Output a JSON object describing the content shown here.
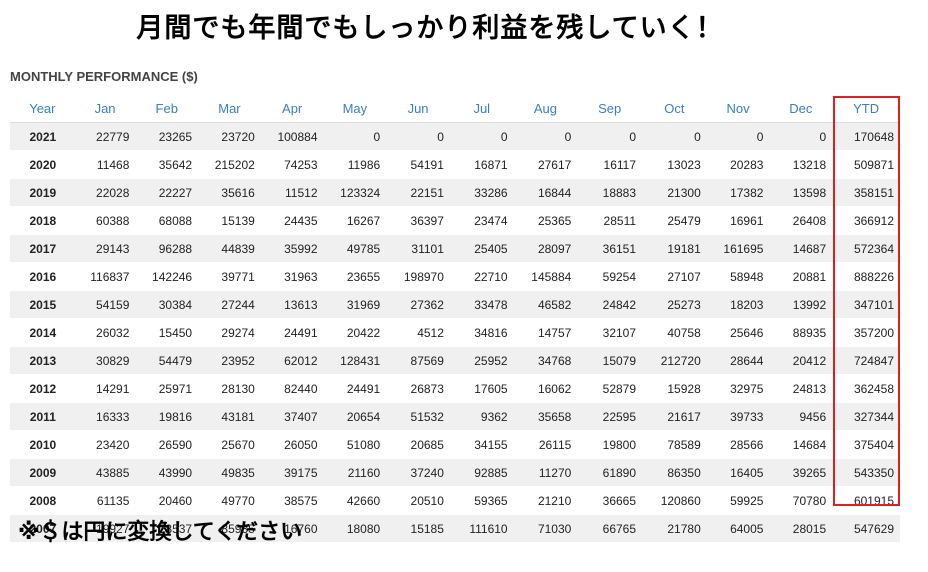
{
  "headline": "月間でも年間でもしっかり利益を残していく！",
  "section_title": "MONTHLY PERFORMANCE ($)",
  "table": {
    "columns": [
      "Year",
      "Jan",
      "Feb",
      "Mar",
      "Apr",
      "May",
      "Jun",
      "Jul",
      "Aug",
      "Sep",
      "Oct",
      "Nov",
      "Dec",
      "YTD"
    ],
    "rows": [
      [
        "2021",
        "22779",
        "23265",
        "23720",
        "100884",
        "0",
        "0",
        "0",
        "0",
        "0",
        "0",
        "0",
        "0",
        "170648"
      ],
      [
        "2020",
        "11468",
        "35642",
        "215202",
        "74253",
        "11986",
        "54191",
        "16871",
        "27617",
        "16117",
        "13023",
        "20283",
        "13218",
        "509871"
      ],
      [
        "2019",
        "22028",
        "22227",
        "35616",
        "11512",
        "123324",
        "22151",
        "33286",
        "16844",
        "18883",
        "21300",
        "17382",
        "13598",
        "358151"
      ],
      [
        "2018",
        "60388",
        "68088",
        "15139",
        "24435",
        "16267",
        "36397",
        "23474",
        "25365",
        "28511",
        "25479",
        "16961",
        "26408",
        "366912"
      ],
      [
        "2017",
        "29143",
        "96288",
        "44839",
        "35992",
        "49785",
        "31101",
        "25405",
        "28097",
        "36151",
        "19181",
        "161695",
        "14687",
        "572364"
      ],
      [
        "2016",
        "116837",
        "142246",
        "39771",
        "31963",
        "23655",
        "198970",
        "22710",
        "145884",
        "59254",
        "27107",
        "58948",
        "20881",
        "888226"
      ],
      [
        "2015",
        "54159",
        "30384",
        "27244",
        "13613",
        "31969",
        "27362",
        "33478",
        "46582",
        "24842",
        "25273",
        "18203",
        "13992",
        "347101"
      ],
      [
        "2014",
        "26032",
        "15450",
        "29274",
        "24491",
        "20422",
        "4512",
        "34816",
        "14757",
        "32107",
        "40758",
        "25646",
        "88935",
        "357200"
      ],
      [
        "2013",
        "30829",
        "54479",
        "23952",
        "62012",
        "128431",
        "87569",
        "25952",
        "34768",
        "15079",
        "212720",
        "28644",
        "20412",
        "724847"
      ],
      [
        "2012",
        "14291",
        "25971",
        "28130",
        "82440",
        "24491",
        "26873",
        "17605",
        "16062",
        "52879",
        "15928",
        "32975",
        "24813",
        "362458"
      ],
      [
        "2011",
        "16333",
        "19816",
        "43181",
        "37407",
        "20654",
        "51532",
        "9362",
        "35658",
        "22595",
        "21617",
        "39733",
        "9456",
        "327344"
      ],
      [
        "2010",
        "23420",
        "26590",
        "25670",
        "26050",
        "51080",
        "20685",
        "34155",
        "26115",
        "19800",
        "78589",
        "28566",
        "14684",
        "375404"
      ],
      [
        "2009",
        "43885",
        "43990",
        "49835",
        "39175",
        "21160",
        "37240",
        "92885",
        "11270",
        "61890",
        "86350",
        "16405",
        "39265",
        "543350"
      ],
      [
        "2008",
        "61135",
        "20460",
        "49770",
        "38575",
        "42660",
        "20510",
        "59365",
        "21210",
        "36665",
        "120860",
        "59925",
        "70780",
        "601915"
      ],
      [
        "2007",
        "19927",
        "28537",
        "85935",
        "16760",
        "18080",
        "15185",
        "111610",
        "71030",
        "66765",
        "21780",
        "64005",
        "28015",
        "547629"
      ]
    ]
  },
  "footnote": "※＄は円に変換してください",
  "colors": {
    "header_text": "#3a7fc2",
    "highlight_border": "#e02020",
    "row_stripe": "#f0f0f0"
  }
}
